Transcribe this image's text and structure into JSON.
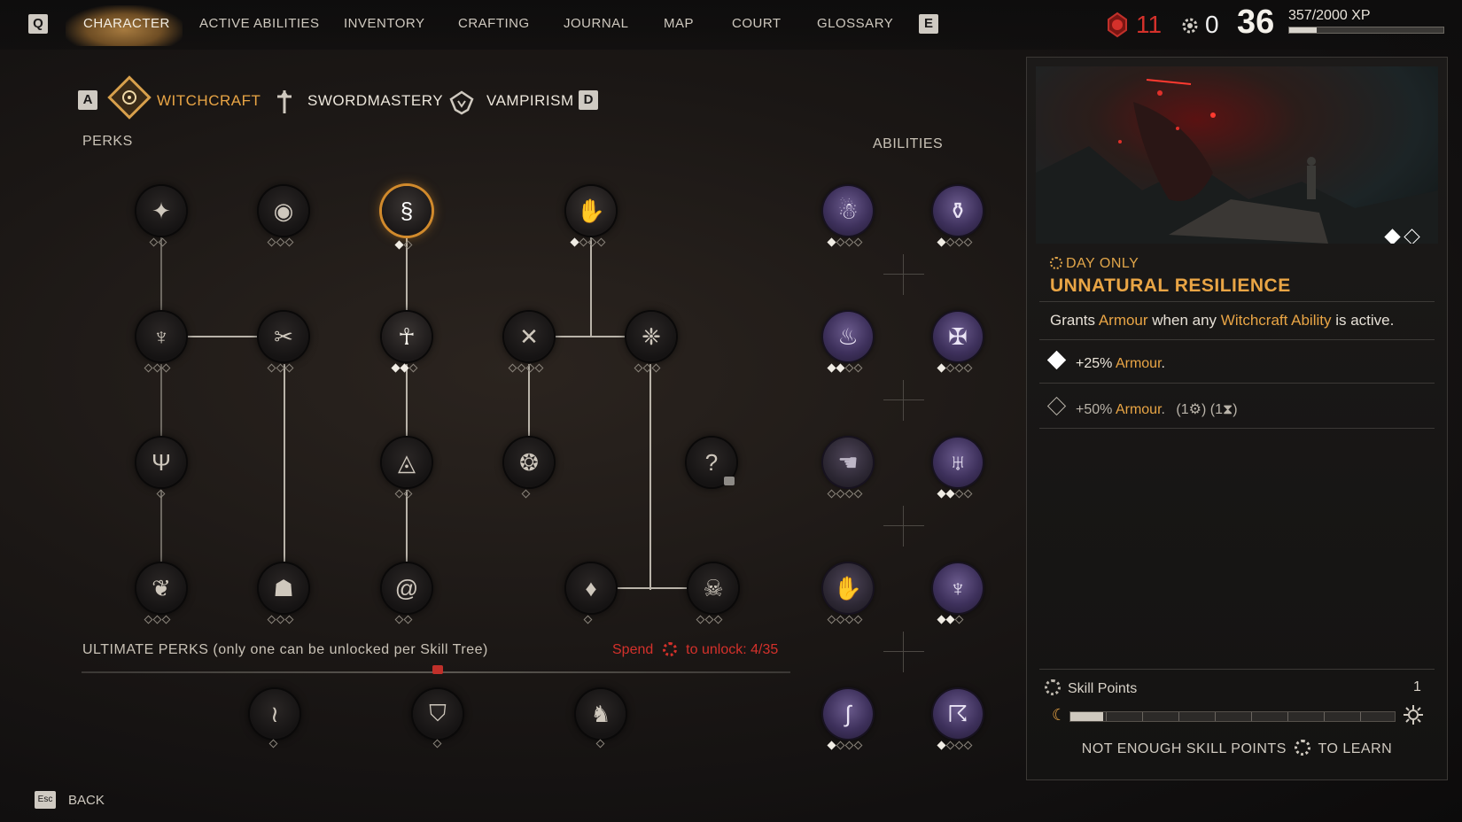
{
  "topbar": {
    "left_key": "Q",
    "right_key": "E",
    "tabs": [
      {
        "label": "CHARACTER"
      },
      {
        "label": "ACTIVE ABILITIES"
      },
      {
        "label": "INVENTORY"
      },
      {
        "label": "CRAFTING"
      },
      {
        "label": "JOURNAL"
      },
      {
        "label": "MAP"
      },
      {
        "label": "COURT"
      },
      {
        "label": "GLOSSARY"
      }
    ],
    "blood_value": "11",
    "skill_points_value": "0",
    "level": "36",
    "xp_text": "357/2000 XP",
    "xp_fraction": 0.18
  },
  "tree_tabs": {
    "left_key": "A",
    "right_key": "D",
    "items": [
      {
        "label": "WITCHCRAFT",
        "active": true
      },
      {
        "label": "SWORDMASTERY",
        "active": false
      },
      {
        "label": "VAMPIRISM",
        "active": false
      }
    ]
  },
  "labels": {
    "perks": "PERKS",
    "abilities": "ABILITIES",
    "ultimate": "ULTIMATE PERKS (only one can be unlocked per Skill Tree)",
    "spend_prefix": "Spend",
    "spend_suffix": "to unlock: 4/35",
    "back_key": "Esc",
    "back": "BACK",
    "unknown_glyph": "?"
  },
  "detail": {
    "condition": "DAY ONLY",
    "title": "UNNATURAL RESILIENCE",
    "desc_parts": [
      "Grants ",
      "Armour",
      " when any ",
      "Witchcraft Ability",
      " is active."
    ],
    "rank1": {
      "value": "+25% ",
      "stat": "Armour",
      "suffix": "."
    },
    "rank2": {
      "value": "+50% ",
      "stat": "Armour",
      "suffix": ".",
      "cost": "(1⚙) (1⧗)"
    },
    "skill_points_label": "Skill Points",
    "skill_points_count": "1",
    "bottom_msg_prefix": "NOT ENOUGH SKILL POINTS",
    "bottom_msg_suffix": "TO LEARN",
    "progress_fraction": 0.1
  },
  "colors": {
    "accent": "#e9a545",
    "danger": "#d4312b",
    "ability_purple": "#4a3b6e"
  },
  "icons": {
    "perk_row1": [
      "dagger-leaf-icon",
      "eye-icon",
      "swirl-face-icon",
      "open-hand-icon"
    ],
    "perk_row2": [
      "mortar-icon",
      "crossed-tools-icon",
      "ankh-icon",
      "crossed-bones-icon",
      "winged-sigil-icon"
    ],
    "perk_row3": [
      "plant-trident-icon",
      "eye-pyramid-icon",
      "flame-circle-icon",
      "locked-unknown-icon"
    ],
    "perk_row4": [
      "potted-plant-icon",
      "helm-icon",
      "spiral-icon",
      "drop-icon",
      "flaming-skull-icon"
    ],
    "ultimate": [
      "serpent-icon",
      "mask-icon",
      "dragon-icon"
    ],
    "abilities": [
      "skull-spirit-icon",
      "coffin-icon",
      "fire-icon",
      "star-cross-icon",
      "clawed-hand-icon",
      "bat-wings-icon",
      "raised-hand-icon",
      "chalice-icon",
      "serpent-sigil-icon",
      "running-figure-icon"
    ]
  }
}
